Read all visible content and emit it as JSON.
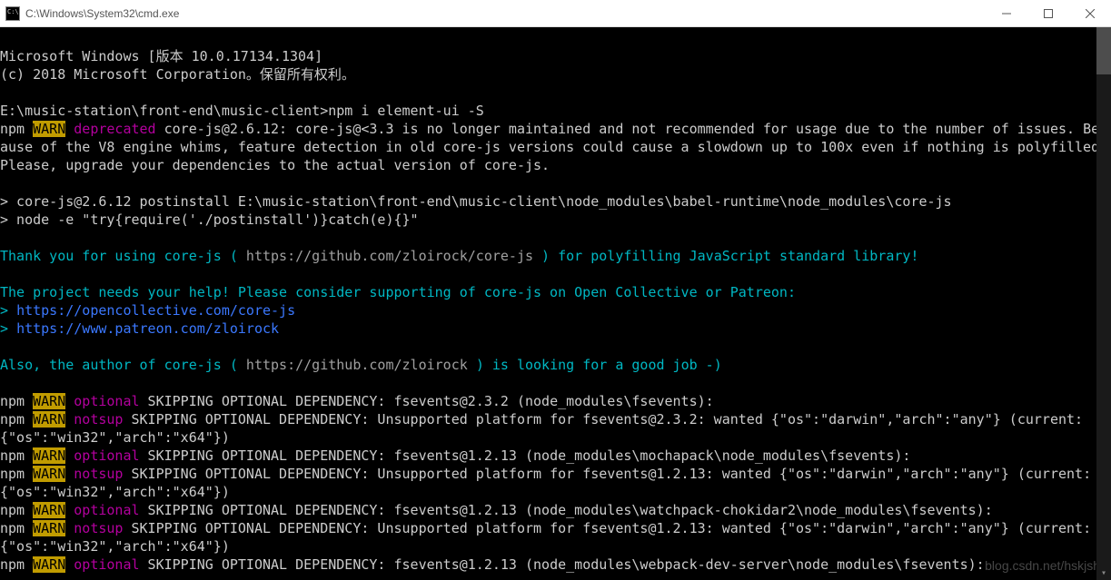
{
  "window": {
    "title": "C:\\Windows\\System32\\cmd.exe"
  },
  "terminal": {
    "header1": "Microsoft Windows [版本 10.0.17134.1304]",
    "header2": "(c) 2018 Microsoft Corporation。保留所有权利。",
    "blank": " ",
    "prompt": "E:\\music-station\\front-end\\music-client>",
    "cmd": "npm i element-ui -S",
    "npm": "npm ",
    "warn": "WARN",
    "sp": " ",
    "deprecated": "deprecated",
    "optional": "optional",
    "notsup": "notsup",
    "dep_msg": " core-js@2.6.12: core-js@<3.3 is no longer maintained and not recommended for usage due to the number of issues. Because of the V8 engine whims, feature detection in old core-js versions could cause a slowdown up to 100x even if nothing is polyfilled. Please, upgrade your dependencies to the actual version of core-js.",
    "post1": "> core-js@2.6.12 postinstall E:\\music-station\\front-end\\music-client\\node_modules\\babel-runtime\\node_modules\\core-js",
    "post2": "> node -e \"try{require('./postinstall')}catch(e){}\"",
    "thank_a": "Thank you for using core-js (",
    "thank_link": " https://github.com/zloirock/core-js ",
    "thank_b": ") for polyfilling JavaScript standard library!",
    "support": "The project needs your help! Please consider supporting of core-js on Open Collective or Patreon:",
    "oc_prefix": "> ",
    "oc_link": "https://opencollective.com/core-js",
    "pat_link": "https://www.patreon.com/zloirock",
    "also_a": "Also, the author of core-js (",
    "also_link": " https://github.com/zloirock ",
    "also_b": ") is looking for a good job -)",
    "skip1": " SKIPPING OPTIONAL DEPENDENCY: fsevents@2.3.2 (node_modules\\fsevents):",
    "skip2": " SKIPPING OPTIONAL DEPENDENCY: Unsupported platform for fsevents@2.3.2: wanted {\"os\":\"darwin\",\"arch\":\"any\"} (current: {\"os\":\"win32\",\"arch\":\"x64\"})",
    "skip3": " SKIPPING OPTIONAL DEPENDENCY: fsevents@1.2.13 (node_modules\\mochapack\\node_modules\\fsevents):",
    "skip4": " SKIPPING OPTIONAL DEPENDENCY: Unsupported platform for fsevents@1.2.13: wanted {\"os\":\"darwin\",\"arch\":\"any\"} (current: {\"os\":\"win32\",\"arch\":\"x64\"})",
    "skip5": " SKIPPING OPTIONAL DEPENDENCY: fsevents@1.2.13 (node_modules\\watchpack-chokidar2\\node_modules\\fsevents):",
    "skip6": " SKIPPING OPTIONAL DEPENDENCY: Unsupported platform for fsevents@1.2.13: wanted {\"os\":\"darwin\",\"arch\":\"any\"} (current: {\"os\":\"win32\",\"arch\":\"x64\"})",
    "skip7": " SKIPPING OPTIONAL DEPENDENCY: fsevents@1.2.13 (node_modules\\webpack-dev-server\\node_modules\\fsevents):"
  },
  "watermark": "blog.csdn.net/hskjsh"
}
